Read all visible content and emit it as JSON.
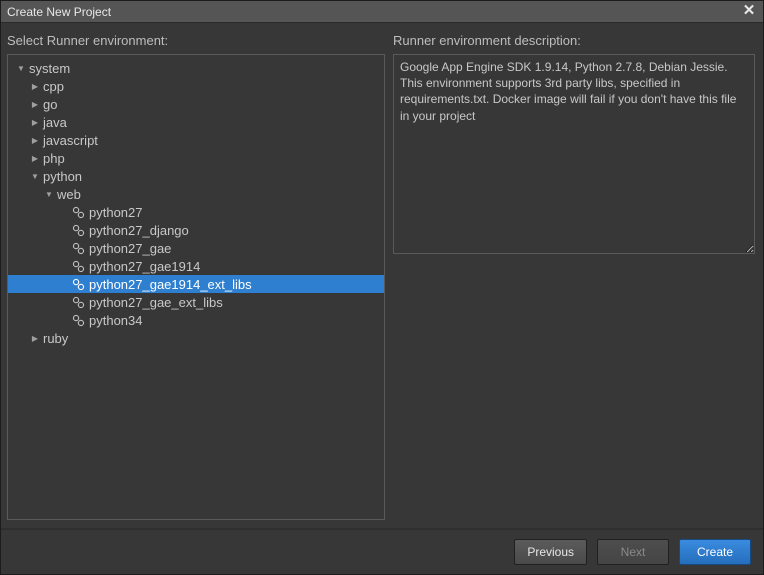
{
  "dialog": {
    "title": "Create New Project",
    "left_label": "Select Runner environment:",
    "right_label": "Runner environment description:",
    "description": "Google App Engine SDK 1.9.14, Python 2.7.8, Debian Jessie. This environment supports 3rd party libs, specified in requirements.txt. Docker image will fail if you don't have this file in your project"
  },
  "tree": [
    {
      "label": "system",
      "kind": "folder",
      "state": "open",
      "depth": 0
    },
    {
      "label": "cpp",
      "kind": "folder",
      "state": "closed",
      "depth": 1
    },
    {
      "label": "go",
      "kind": "folder",
      "state": "closed",
      "depth": 1
    },
    {
      "label": "java",
      "kind": "folder",
      "state": "closed",
      "depth": 1
    },
    {
      "label": "javascript",
      "kind": "folder",
      "state": "closed",
      "depth": 1
    },
    {
      "label": "php",
      "kind": "folder",
      "state": "closed",
      "depth": 1
    },
    {
      "label": "python",
      "kind": "folder",
      "state": "open",
      "depth": 1
    },
    {
      "label": "web",
      "kind": "folder",
      "state": "open",
      "depth": 2
    },
    {
      "label": "python27",
      "kind": "runner",
      "state": "none",
      "depth": 3
    },
    {
      "label": "python27_django",
      "kind": "runner",
      "state": "none",
      "depth": 3
    },
    {
      "label": "python27_gae",
      "kind": "runner",
      "state": "none",
      "depth": 3
    },
    {
      "label": "python27_gae1914",
      "kind": "runner",
      "state": "none",
      "depth": 3
    },
    {
      "label": "python27_gae1914_ext_libs",
      "kind": "runner",
      "state": "none",
      "depth": 3,
      "selected": true
    },
    {
      "label": "python27_gae_ext_libs",
      "kind": "runner",
      "state": "none",
      "depth": 3
    },
    {
      "label": "python34",
      "kind": "runner",
      "state": "none",
      "depth": 3
    },
    {
      "label": "ruby",
      "kind": "folder",
      "state": "closed",
      "depth": 1
    }
  ],
  "buttons": {
    "previous": "Previous",
    "next": "Next",
    "create": "Create"
  }
}
